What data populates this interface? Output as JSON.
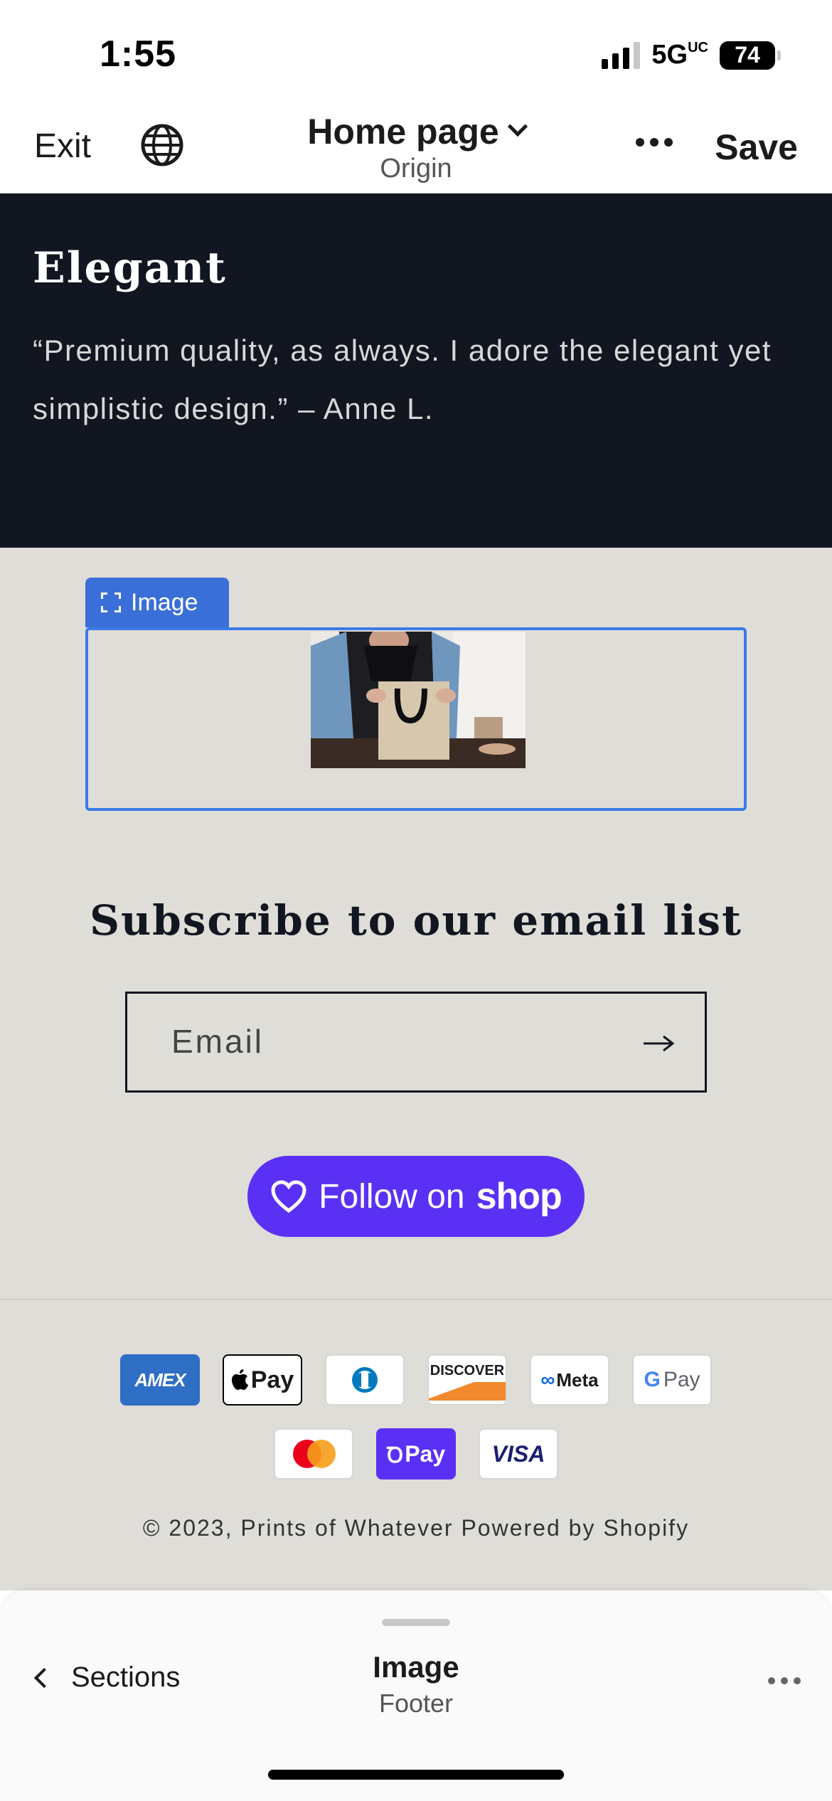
{
  "status_bar": {
    "time": "1:55",
    "network": "5G",
    "network_suffix": "UC",
    "battery": "74"
  },
  "header": {
    "exit_label": "Exit",
    "title": "Home page",
    "subtitle": "Origin",
    "save_label": "Save"
  },
  "testimonial": {
    "heading": "Elegant",
    "quote": "“Premium quality, as always. I adore the elegant yet simplistic design.” – Anne L."
  },
  "image_block": {
    "tag_label": "Image"
  },
  "newsletter": {
    "title": "Subscribe to our email list",
    "email_placeholder": "Email"
  },
  "follow_button": {
    "label": "Follow on",
    "brand": "shop"
  },
  "payments": {
    "row1": [
      "AMEX",
      "Pay",
      "Diners Club",
      "DISCOVER",
      "Meta",
      "Pay"
    ],
    "row2": [
      "Mastercard",
      "Pay",
      "VISA"
    ]
  },
  "copyright": "© 2023, Prints of Whatever Powered by Shopify",
  "bottom_sheet": {
    "back_label": "Sections",
    "title": "Image",
    "subtitle": "Footer"
  },
  "colors": {
    "dark_section": "#121620",
    "light_section": "#dfddd8",
    "selection_blue": "#3b7ae6",
    "shop_purple": "#5a31f4"
  }
}
